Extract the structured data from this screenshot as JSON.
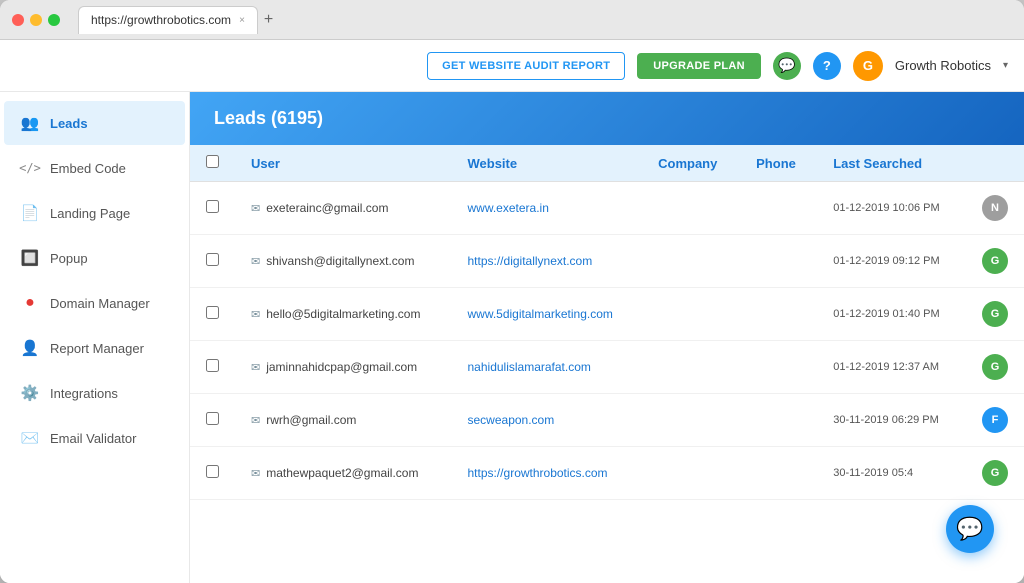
{
  "browser": {
    "url": "https://growthrobotics.com",
    "tab_close": "×",
    "tab_add": "+"
  },
  "topbar": {
    "audit_btn": "GET WEBSITE AUDIT REPORT",
    "upgrade_btn": "UPGRADE PLAN",
    "chat_icon": "💬",
    "help_icon": "?",
    "user_initial": "G",
    "user_name": "Growth Robotics",
    "chevron": "▾"
  },
  "sidebar": {
    "items": [
      {
        "id": "leads",
        "label": "Leads",
        "icon": "👥",
        "active": true
      },
      {
        "id": "embed-code",
        "label": "Embed Code",
        "icon": "</>",
        "active": false
      },
      {
        "id": "landing-page",
        "label": "Landing Page",
        "icon": "📄",
        "active": false
      },
      {
        "id": "popup",
        "label": "Popup",
        "icon": "🔲",
        "active": false
      },
      {
        "id": "domain-manager",
        "label": "Domain Manager",
        "icon": "🔴",
        "active": false
      },
      {
        "id": "report-manager",
        "label": "Report Manager",
        "icon": "👤",
        "active": false
      },
      {
        "id": "integrations",
        "label": "Integrations",
        "icon": "⚙️",
        "active": false
      },
      {
        "id": "email-validator",
        "label": "Email Validator",
        "icon": "✉️",
        "active": false
      }
    ]
  },
  "content": {
    "header_title": "Leads (6195)",
    "columns": [
      "User",
      "Website",
      "Company",
      "Phone",
      "Last Searched"
    ],
    "rows": [
      {
        "email": "exeterainc@gmail.com",
        "website": "www.exetera.in",
        "company": "",
        "phone": "",
        "last_searched": "01-12-2019 10:06 PM",
        "avatar_color": "#9E9E9E",
        "avatar_text": "N"
      },
      {
        "email": "shivansh@digitallynext.com",
        "website": "https://digitallynext.com",
        "company": "",
        "phone": "",
        "last_searched": "01-12-2019 09:12 PM",
        "avatar_color": "#4CAF50",
        "avatar_text": "G"
      },
      {
        "email": "hello@5digitalmarketing.com",
        "website": "www.5digitalmarketing.com",
        "company": "",
        "phone": "",
        "last_searched": "01-12-2019 01:40 PM",
        "avatar_color": "#4CAF50",
        "avatar_text": "G"
      },
      {
        "email": "jaminnahidcpap@gmail.com",
        "website": "nahidulislamarafat.com",
        "company": "",
        "phone": "",
        "last_searched": "01-12-2019 12:37 AM",
        "avatar_color": "#4CAF50",
        "avatar_text": "G"
      },
      {
        "email": "rwrh@gmail.com",
        "website": "secweapon.com",
        "company": "",
        "phone": "",
        "last_searched": "30-11-2019 06:29 PM",
        "avatar_color": "#2196F3",
        "avatar_text": "F"
      },
      {
        "email": "mathewpaquet2@gmail.com",
        "website": "https://growthrobotics.com",
        "company": "",
        "phone": "",
        "last_searched": "30-11-2019 05:4",
        "avatar_color": "#4CAF50",
        "avatar_text": "G"
      }
    ]
  },
  "fab": {
    "icon": "💬"
  }
}
